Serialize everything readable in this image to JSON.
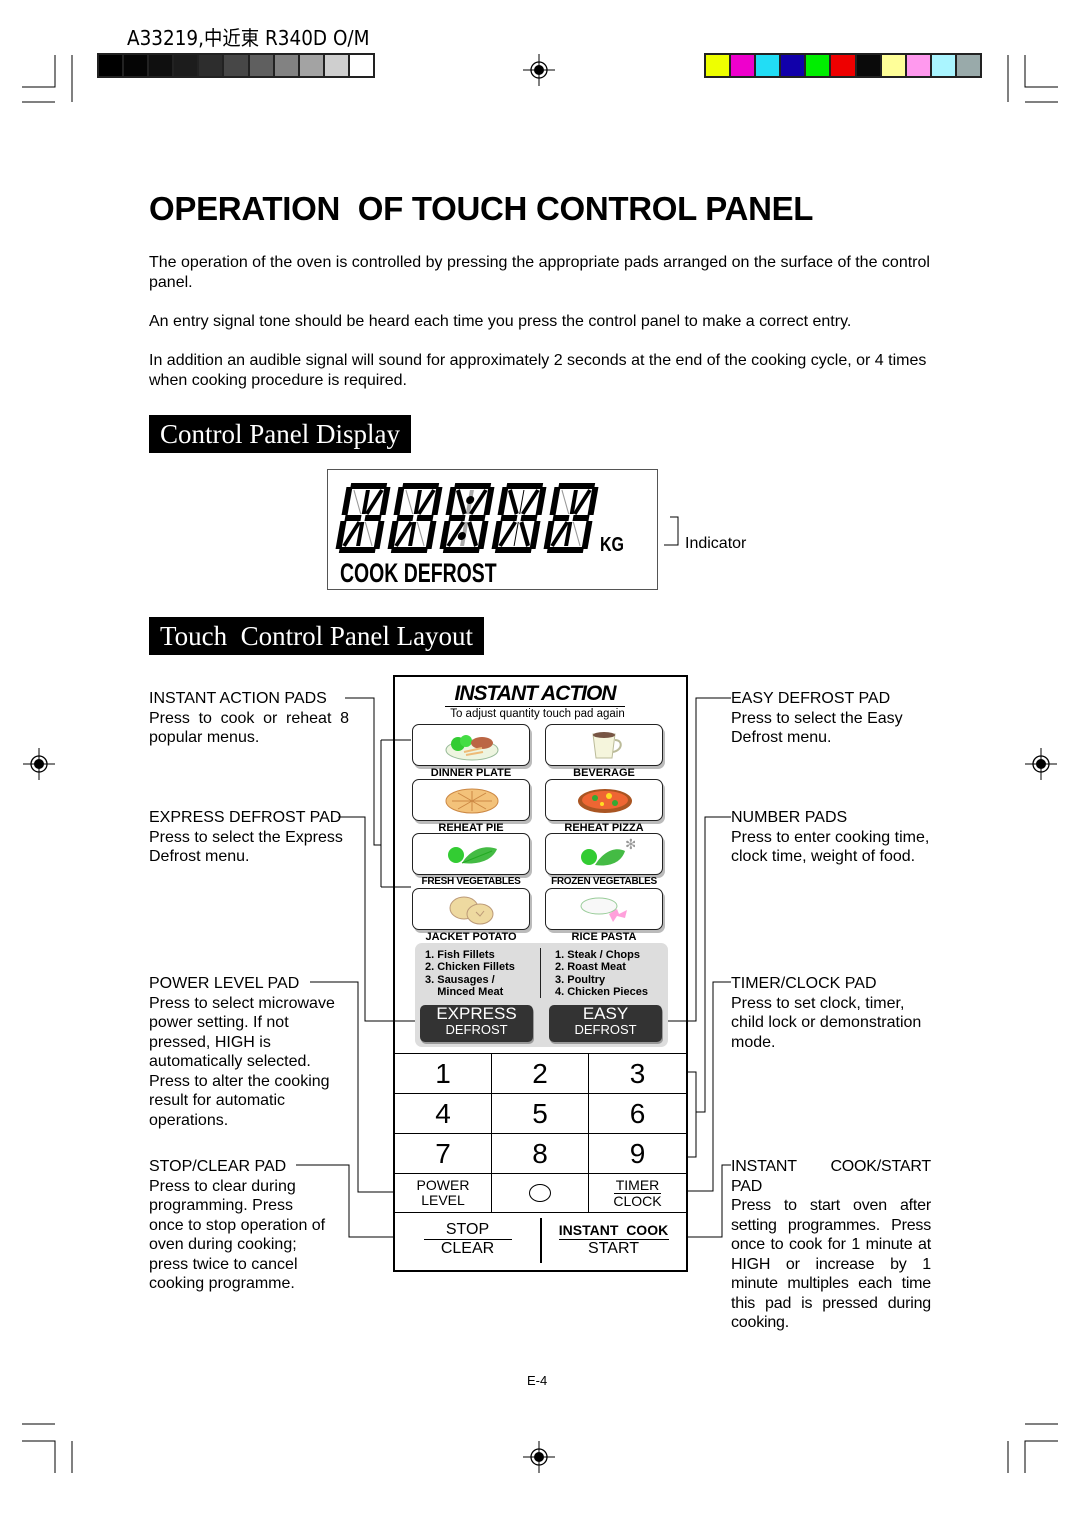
{
  "header": {
    "code": "A33219,中近東 R340D O/M"
  },
  "calibration": {
    "grayscale": [
      "#000000",
      "#050505",
      "#0f0f0f",
      "#1c1c1c",
      "#2d2d2d",
      "#474747",
      "#5f5f5f",
      "#828282",
      "#a3a3a3",
      "#cfcfcf",
      "#ffffff"
    ],
    "colors": [
      "#eeff00",
      "#ee00cc",
      "#22ddf5",
      "#1100aa",
      "#00ee00",
      "#ee0000",
      "#0a0a0a",
      "#ffff99",
      "#ff99ee",
      "#aaf5ff",
      "#99aaaa"
    ]
  },
  "title": "OPERATION  OF TOUCH CONTROL PANEL",
  "paragraphs": [
    "The operation of the oven is controlled by pressing the appropriate pads arranged on the surface of the control panel.",
    "An entry signal tone should be heard each time you press the control panel to make a correct entry.",
    "In addition an audible signal will sound for approximately 2 seconds at the end of the cooking cycle, or 4 times when cooking procedure is required."
  ],
  "display_section": {
    "heading": "Control Panel Display",
    "unit": "KG",
    "modes": "COOK DEFROST",
    "indicator_label": "Indicator"
  },
  "layout_section": {
    "heading": "Touch  Control Panel Layout"
  },
  "panel": {
    "title": "INSTANT ACTION",
    "subtitle": "To adjust quantity touch pad again",
    "pads": [
      {
        "label": "DINNER PLATE",
        "icon": "dinner-plate-icon"
      },
      {
        "label": "BEVERAGE",
        "icon": "cup-icon"
      },
      {
        "label": "REHEAT PIE",
        "icon": "pie-icon"
      },
      {
        "label": "REHEAT PIZZA",
        "icon": "pizza-icon"
      },
      {
        "label": "FRESH VEGETABLES",
        "icon": "vegetables-icon"
      },
      {
        "label": "FROZEN VEGETABLES",
        "icon": "frozen-vegetables-icon"
      },
      {
        "label": "JACKET POTATO",
        "icon": "potato-icon"
      },
      {
        "label": "RICE PASTA",
        "icon": "rice-pasta-icon"
      }
    ],
    "express_list": [
      "1. Fish Fillets",
      "2. Chicken Fillets",
      "3. Sausages /",
      "    Minced Meat"
    ],
    "easy_list": [
      "1. Steak / Chops",
      "2. Roast Meat",
      "3. Poultry",
      "4. Chicken Pieces"
    ],
    "express_btn": {
      "top": "EXPRESS",
      "bottom": "DEFROST"
    },
    "easy_btn": {
      "top": "EASY",
      "bottom": "DEFROST"
    },
    "keys": [
      "1",
      "2",
      "3",
      "4",
      "5",
      "6",
      "7",
      "8",
      "9"
    ],
    "power": {
      "top": "POWER",
      "bottom": "LEVEL"
    },
    "zero": "O",
    "timer": {
      "top": "TIMER",
      "bottom": "CLOCK"
    },
    "stop": {
      "top": "STOP",
      "bottom": "CLEAR"
    },
    "start": {
      "top": "INSTANT  COOK",
      "bottom": "START"
    }
  },
  "left_labels": [
    {
      "head": "INSTANT ACTION PADS",
      "body": "Press to cook or reheat 8 popular menus."
    },
    {
      "head": "EXPRESS DEFROST PAD",
      "body": "Press to select the Express Defrost menu."
    },
    {
      "head": "POWER LEVEL PAD",
      "body": "Press to select microwave power setting. If not pressed, HIGH is automatically selected. Press to alter the cooking result for automatic operations."
    },
    {
      "head": "STOP/CLEAR PAD",
      "body": "Press to clear during programming. Press once to stop operation of oven during cooking; press twice to cancel cooking programme."
    }
  ],
  "right_labels": [
    {
      "head": "EASY DEFROST PAD",
      "body": "Press to select the Easy Defrost menu."
    },
    {
      "head": "NUMBER PADS",
      "body": "Press to enter cooking time, clock time, weight of food."
    },
    {
      "head": "TIMER/CLOCK PAD",
      "body": "Press to set clock, timer, child lock or demonstration mode."
    },
    {
      "head": "INSTANT COOK/START PAD",
      "body": "Press to start oven after setting programmes. Press once to cook for 1 minute at HIGH or increase by 1 minute multiples each time this pad is pressed during cooking."
    }
  ],
  "page_number": "E-4"
}
